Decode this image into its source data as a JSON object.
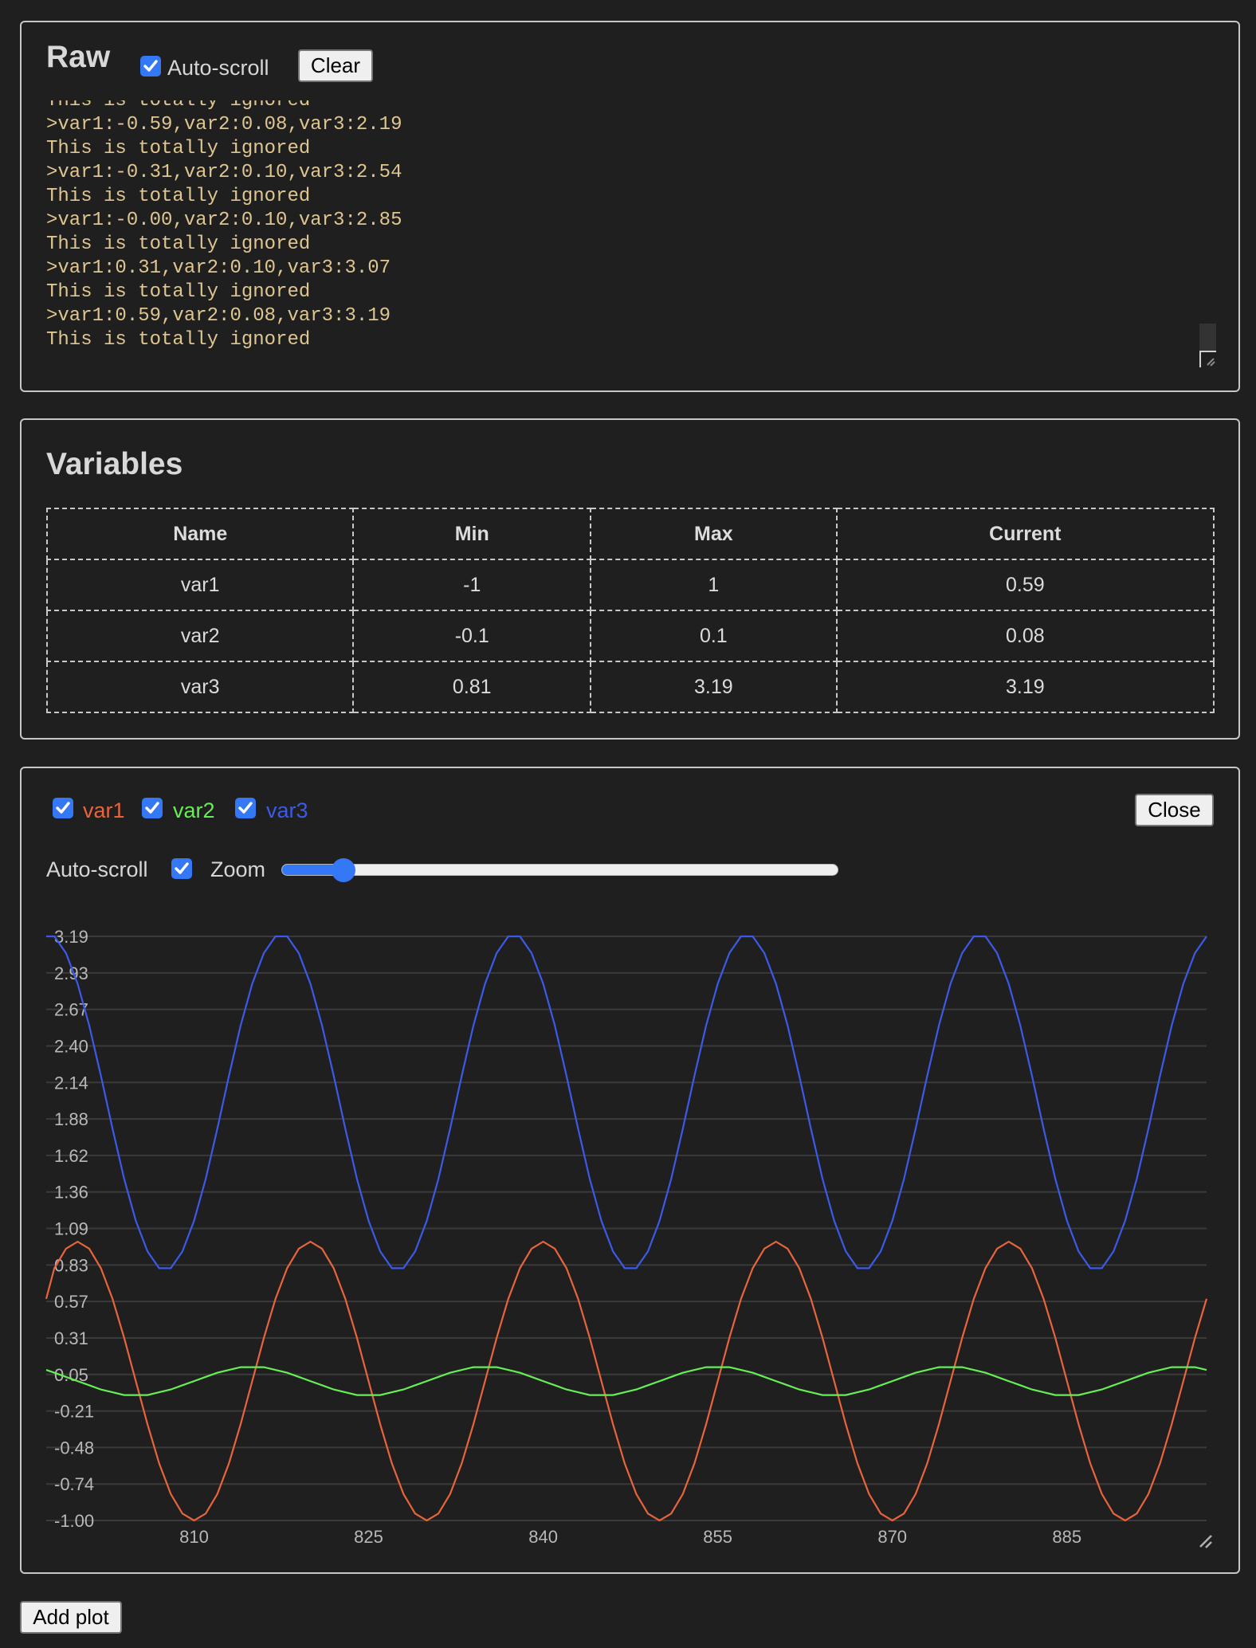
{
  "raw": {
    "title": "Raw",
    "autoscroll_label": "Auto-scroll",
    "autoscroll_checked": true,
    "clear_label": "Clear",
    "lines": [
      "This is totally ignored",
      ">var1:-0.59,var2:0.08,var3:2.19",
      "This is totally ignored",
      ">var1:-0.31,var2:0.10,var3:2.54",
      "This is totally ignored",
      ">var1:-0.00,var2:0.10,var3:2.85",
      "This is totally ignored",
      ">var1:0.31,var2:0.10,var3:3.07",
      "This is totally ignored",
      ">var1:0.59,var2:0.08,var3:3.19",
      "This is totally ignored"
    ]
  },
  "variables": {
    "title": "Variables",
    "columns": [
      "Name",
      "Min",
      "Max",
      "Current"
    ],
    "rows": [
      [
        "var1",
        "-1",
        "1",
        "0.59"
      ],
      [
        "var2",
        "-0.1",
        "0.1",
        "0.08"
      ],
      [
        "var3",
        "0.81",
        "3.19",
        "3.19"
      ]
    ]
  },
  "plot": {
    "series_toggles": [
      {
        "label": "var1",
        "checked": true,
        "color": "#e8643c"
      },
      {
        "label": "var2",
        "checked": true,
        "color": "#66ee55"
      },
      {
        "label": "var3",
        "checked": true,
        "color": "#3c5ae8"
      }
    ],
    "close_label": "Close",
    "autoscroll_label": "Auto-scroll",
    "autoscroll_checked": true,
    "zoom_label": "Zoom",
    "zoom_fraction": 0.11
  },
  "add_plot_label": "Add plot",
  "chart_data": {
    "type": "line",
    "title": "",
    "xlabel": "",
    "ylabel": "",
    "xlim": [
      797.3,
      897
    ],
    "ylim": [
      -1.0,
      3.19
    ],
    "grid": true,
    "x_start": 797,
    "x_end": 897,
    "x_ticks": [
      810,
      825,
      840,
      855,
      870,
      885
    ],
    "x_tick_labels": [
      "810",
      "825",
      "840",
      "855",
      "870",
      "885"
    ],
    "y_tick_labels": [
      "3.19",
      "2.93",
      "2.67",
      "2.40",
      "2.14",
      "1.88",
      "1.62",
      "1.36",
      "1.09",
      "0.83",
      "0.57",
      "0.31",
      "0.05",
      "-0.21",
      "-0.48",
      "-0.74",
      "-1.00"
    ],
    "series": [
      {
        "name": "var1",
        "color": "#e8643c",
        "formula": "sin(18deg*(x-797)+36deg)",
        "period": 20,
        "min": -1,
        "max": 1,
        "last": 0.59
      },
      {
        "name": "var2",
        "color": "#66ee55",
        "formula": "0.1*cos(18deg*(x-797)+36deg)",
        "period": 20,
        "min": -0.1,
        "max": 0.1,
        "last": 0.08
      },
      {
        "name": "var3",
        "color": "#3c5ae8",
        "formula": "2+1.205*cos(18deg*(x-797)-9deg)",
        "period": 20,
        "min": 0.81,
        "max": 3.19,
        "last": 3.19
      }
    ]
  }
}
